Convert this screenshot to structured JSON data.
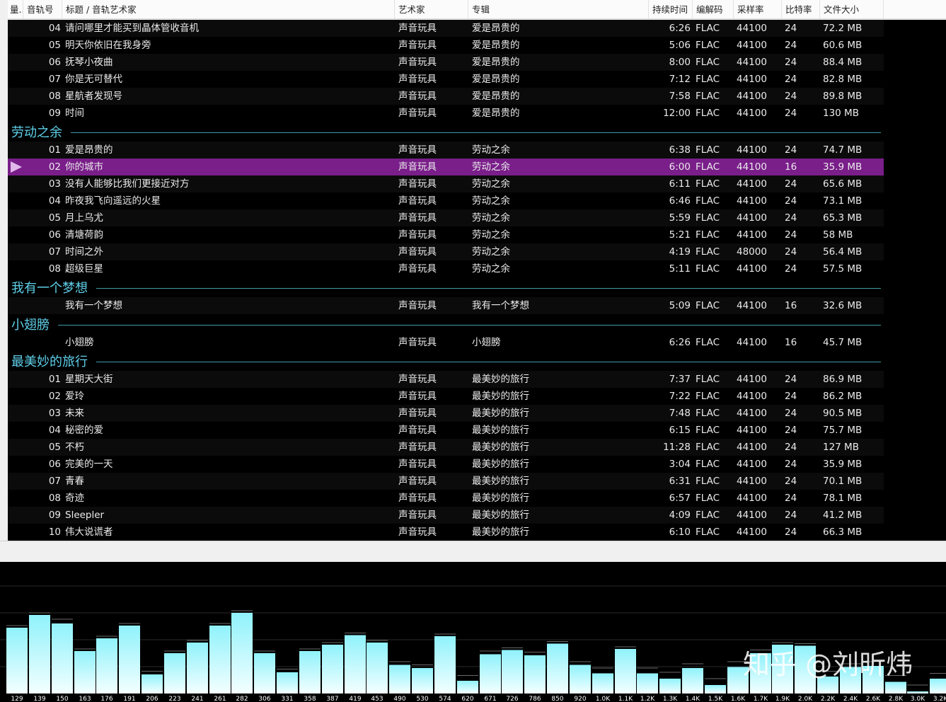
{
  "columns": {
    "status": "量..",
    "track": "音轨号",
    "title": "标题 / 音轨艺术家",
    "artist": "艺术家",
    "album": "专辑",
    "duration": "持续时间",
    "codec": "编解码",
    "samplerate": "采样率",
    "bitdepth": "比特率",
    "filesize": "文件大小"
  },
  "colors": {
    "playing_row": "#7a1e8a",
    "group_title": "#5fd0ea",
    "spectrum_top": "#8ff2fb",
    "spectrum_bottom": "#f4ffff"
  },
  "playlist": [
    {
      "type": "track",
      "num": "04",
      "title": "请问哪里才能买到晶体管收音机",
      "artist": "声音玩具",
      "album": "爱是昂贵的",
      "duration": "6:26",
      "codec": "FLAC",
      "rate": "44100",
      "bits": "24",
      "size": "72.2 MB"
    },
    {
      "type": "track",
      "num": "05",
      "title": "明天你依旧在我身旁",
      "artist": "声音玩具",
      "album": "爱是昂贵的",
      "duration": "5:06",
      "codec": "FLAC",
      "rate": "44100",
      "bits": "24",
      "size": "60.6 MB"
    },
    {
      "type": "track",
      "num": "06",
      "title": "抚琴小夜曲",
      "artist": "声音玩具",
      "album": "爱是昂贵的",
      "duration": "8:00",
      "codec": "FLAC",
      "rate": "44100",
      "bits": "24",
      "size": "88.4 MB"
    },
    {
      "type": "track",
      "num": "07",
      "title": "你是无可替代",
      "artist": "声音玩具",
      "album": "爱是昂贵的",
      "duration": "7:12",
      "codec": "FLAC",
      "rate": "44100",
      "bits": "24",
      "size": "82.8 MB"
    },
    {
      "type": "track",
      "num": "08",
      "title": "星航者发现号",
      "artist": "声音玩具",
      "album": "爱是昂贵的",
      "duration": "7:58",
      "codec": "FLAC",
      "rate": "44100",
      "bits": "24",
      "size": "89.8 MB"
    },
    {
      "type": "track",
      "num": "09",
      "title": "时间",
      "artist": "声音玩具",
      "album": "爱是昂贵的",
      "duration": "12:00",
      "codec": "FLAC",
      "rate": "44100",
      "bits": "24",
      "size": "130 MB"
    },
    {
      "type": "group",
      "title": "劳动之余"
    },
    {
      "type": "track",
      "num": "01",
      "title": "爱是昂贵的",
      "artist": "声音玩具",
      "album": "劳动之余",
      "duration": "6:38",
      "codec": "FLAC",
      "rate": "44100",
      "bits": "24",
      "size": "74.7 MB"
    },
    {
      "type": "track",
      "num": "02",
      "title": "你的城市",
      "artist": "声音玩具",
      "album": "劳动之余",
      "duration": "6:00",
      "codec": "FLAC",
      "rate": "44100",
      "bits": "16",
      "size": "35.9 MB",
      "playing": true
    },
    {
      "type": "track",
      "num": "03",
      "title": "没有人能够比我们更接近对方",
      "artist": "声音玩具",
      "album": "劳动之余",
      "duration": "6:11",
      "codec": "FLAC",
      "rate": "44100",
      "bits": "24",
      "size": "65.6 MB"
    },
    {
      "type": "track",
      "num": "04",
      "title": "昨夜我飞向遥远的火星",
      "artist": "声音玩具",
      "album": "劳动之余",
      "duration": "6:46",
      "codec": "FLAC",
      "rate": "44100",
      "bits": "24",
      "size": "73.1 MB"
    },
    {
      "type": "track",
      "num": "05",
      "title": "月上乌尤",
      "artist": "声音玩具",
      "album": "劳动之余",
      "duration": "5:59",
      "codec": "FLAC",
      "rate": "44100",
      "bits": "24",
      "size": "65.3 MB"
    },
    {
      "type": "track",
      "num": "06",
      "title": "清塘荷韵",
      "artist": "声音玩具",
      "album": "劳动之余",
      "duration": "5:21",
      "codec": "FLAC",
      "rate": "44100",
      "bits": "24",
      "size": "58 MB"
    },
    {
      "type": "track",
      "num": "07",
      "title": "时间之外",
      "artist": "声音玩具",
      "album": "劳动之余",
      "duration": "4:19",
      "codec": "FLAC",
      "rate": "48000",
      "bits": "24",
      "size": "56.4 MB"
    },
    {
      "type": "track",
      "num": "08",
      "title": "超级巨星",
      "artist": "声音玩具",
      "album": "劳动之余",
      "duration": "5:11",
      "codec": "FLAC",
      "rate": "44100",
      "bits": "24",
      "size": "57.5 MB"
    },
    {
      "type": "group",
      "title": "我有一个梦想"
    },
    {
      "type": "track",
      "num": "",
      "title": "我有一个梦想",
      "artist": "声音玩具",
      "album": "我有一个梦想",
      "duration": "5:09",
      "codec": "FLAC",
      "rate": "44100",
      "bits": "16",
      "size": "32.6 MB"
    },
    {
      "type": "group",
      "title": "小翅膀"
    },
    {
      "type": "track",
      "num": "",
      "title": "小翅膀",
      "artist": "声音玩具",
      "album": "小翅膀",
      "duration": "6:26",
      "codec": "FLAC",
      "rate": "44100",
      "bits": "16",
      "size": "45.7 MB"
    },
    {
      "type": "group",
      "title": "最美妙的旅行"
    },
    {
      "type": "track",
      "num": "01",
      "title": "星期天大街",
      "artist": "声音玩具",
      "album": "最美妙的旅行",
      "duration": "7:37",
      "codec": "FLAC",
      "rate": "44100",
      "bits": "24",
      "size": "86.9 MB"
    },
    {
      "type": "track",
      "num": "02",
      "title": "爱玲",
      "artist": "声音玩具",
      "album": "最美妙的旅行",
      "duration": "7:22",
      "codec": "FLAC",
      "rate": "44100",
      "bits": "24",
      "size": "86.2 MB"
    },
    {
      "type": "track",
      "num": "03",
      "title": "未来",
      "artist": "声音玩具",
      "album": "最美妙的旅行",
      "duration": "7:48",
      "codec": "FLAC",
      "rate": "44100",
      "bits": "24",
      "size": "90.5 MB"
    },
    {
      "type": "track",
      "num": "04",
      "title": "秘密的爱",
      "artist": "声音玩具",
      "album": "最美妙的旅行",
      "duration": "6:15",
      "codec": "FLAC",
      "rate": "44100",
      "bits": "24",
      "size": "75.7 MB"
    },
    {
      "type": "track",
      "num": "05",
      "title": "不朽",
      "artist": "声音玩具",
      "album": "最美妙的旅行",
      "duration": "11:28",
      "codec": "FLAC",
      "rate": "44100",
      "bits": "24",
      "size": "127 MB"
    },
    {
      "type": "track",
      "num": "06",
      "title": "完美的一天",
      "artist": "声音玩具",
      "album": "最美妙的旅行",
      "duration": "3:04",
      "codec": "FLAC",
      "rate": "44100",
      "bits": "24",
      "size": "35.9 MB"
    },
    {
      "type": "track",
      "num": "07",
      "title": "青春",
      "artist": "声音玩具",
      "album": "最美妙的旅行",
      "duration": "6:31",
      "codec": "FLAC",
      "rate": "44100",
      "bits": "24",
      "size": "70.1 MB"
    },
    {
      "type": "track",
      "num": "08",
      "title": "奇迹",
      "artist": "声音玩具",
      "album": "最美妙的旅行",
      "duration": "6:57",
      "codec": "FLAC",
      "rate": "44100",
      "bits": "24",
      "size": "78.1 MB"
    },
    {
      "type": "track",
      "num": "09",
      "title": "Sleepler",
      "artist": "声音玩具",
      "album": "最美妙的旅行",
      "duration": "4:09",
      "codec": "FLAC",
      "rate": "44100",
      "bits": "24",
      "size": "41.2 MB"
    },
    {
      "type": "track",
      "num": "10",
      "title": "伟大说谎者",
      "artist": "声音玩具",
      "album": "最美妙的旅行",
      "duration": "6:10",
      "codec": "FLAC",
      "rate": "44100",
      "bits": "24",
      "size": "66.3 MB"
    }
  ],
  "spectrum": {
    "frequency_labels": [
      "129",
      "139",
      "150",
      "163",
      "176",
      "191",
      "206",
      "223",
      "241",
      "261",
      "282",
      "306",
      "331",
      "358",
      "387",
      "419",
      "453",
      "490",
      "530",
      "574",
      "620",
      "671",
      "726",
      "786",
      "850",
      "920",
      "1.0K",
      "1.1K",
      "1.2K",
      "1.3K",
      "1.4K",
      "1.5K",
      "1.6K",
      "1.7K",
      "1.9K",
      "2.0K",
      "2.2K",
      "2.4K",
      "2.6K",
      "2.8K",
      "3.0K",
      "3.2K"
    ],
    "levels": [
      0.62,
      0.74,
      0.66,
      0.4,
      0.52,
      0.64,
      0.18,
      0.38,
      0.48,
      0.64,
      0.76,
      0.38,
      0.2,
      0.4,
      0.46,
      0.55,
      0.48,
      0.27,
      0.24,
      0.54,
      0.12,
      0.37,
      0.41,
      0.36,
      0.47,
      0.27,
      0.19,
      0.42,
      0.19,
      0.14,
      0.24,
      0.08,
      0.25,
      0.38,
      0.46,
      0.45,
      0.16,
      0.25,
      0.26,
      0.11,
      0.02,
      0.14
    ],
    "peaks": [
      0.64,
      0.76,
      0.7,
      0.42,
      0.54,
      0.66,
      0.21,
      0.4,
      0.5,
      0.66,
      0.78,
      0.4,
      0.23,
      0.42,
      0.48,
      0.57,
      0.5,
      0.3,
      0.27,
      0.56,
      0.17,
      0.4,
      0.43,
      0.39,
      0.49,
      0.3,
      0.24,
      0.44,
      0.24,
      0.2,
      0.28,
      0.14,
      0.3,
      0.41,
      0.48,
      0.47,
      0.21,
      0.28,
      0.3,
      0.17,
      0.08,
      0.19
    ]
  },
  "watermark": "知乎 @刘昕炜"
}
